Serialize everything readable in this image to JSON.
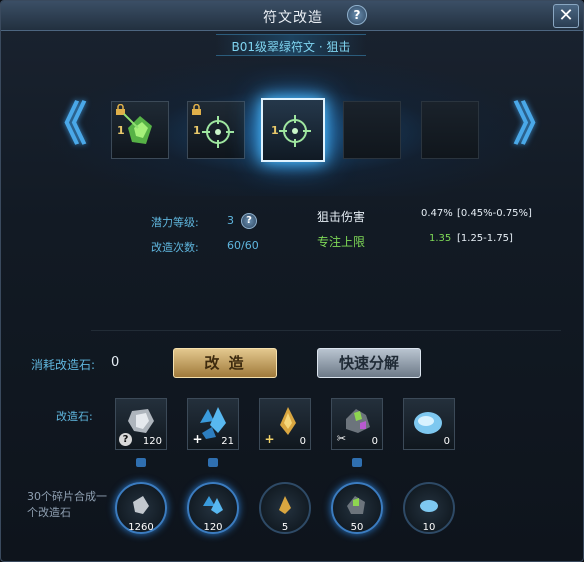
{
  "window": {
    "title": "符文改造",
    "close_label": "✕",
    "help_label": "?"
  },
  "rune": {
    "name": "B01级翠绿符文 · 狙击"
  },
  "navigation": {
    "prev_icon": "chevron-left-icon",
    "next_icon": "chevron-right-icon",
    "prev_label": "《",
    "next_label": "》"
  },
  "slots": [
    {
      "level": "1",
      "locked": true,
      "icon": "green-shard-icon",
      "active": false
    },
    {
      "level": "1",
      "locked": true,
      "icon": "crosshair-icon",
      "active": false
    },
    {
      "level": "1",
      "locked": false,
      "icon": "crosshair-icon",
      "active": true
    },
    {
      "level": "",
      "locked": false,
      "icon": "",
      "active": false
    },
    {
      "level": "",
      "locked": false,
      "icon": "",
      "active": false
    }
  ],
  "stats": {
    "potential_label": "潜力等级:",
    "potential_value": "3",
    "reforge_count_label": "改造次数:",
    "reforge_count_value": "60/60",
    "attr1_name": "狙击伤害",
    "attr1_value": "0.47%",
    "attr1_range": "[0.45%-0.75%]",
    "attr2_name": "专注上限",
    "attr2_value": "1.35",
    "attr2_range": "[1.25-1.75]",
    "help_label": "?"
  },
  "consume": {
    "label": "消耗改造石:",
    "value": "0"
  },
  "buttons": {
    "reforge": "改 造",
    "decompose": "快速分解"
  },
  "stones": {
    "label": "改造石:",
    "items": [
      {
        "icon": "gray-ore-icon",
        "badge": "?",
        "count": "120"
      },
      {
        "icon": "blue-crystal-icon",
        "badge": "+",
        "count": "21"
      },
      {
        "icon": "gold-crystal-icon",
        "badge": "+",
        "count": "0"
      },
      {
        "icon": "green-ore-icon",
        "badge": "✂",
        "count": "0"
      },
      {
        "icon": "blue-gem-icon",
        "badge": "",
        "count": "0"
      }
    ]
  },
  "fragments": {
    "label": "30个碎片合成一个改造石",
    "items": [
      {
        "icon": "gray-fragment-icon",
        "count": "1260"
      },
      {
        "icon": "blue-fragment-icon",
        "count": "120"
      },
      {
        "icon": "gold-fragment-icon",
        "count": "5"
      },
      {
        "icon": "green-fragment-icon",
        "count": "50"
      },
      {
        "icon": "gem-fragment-icon",
        "count": "10"
      }
    ]
  },
  "colors": {
    "accent_blue": "#5fb6de",
    "gold_button": "#e3c88e",
    "green_stat": "#7ed957"
  }
}
